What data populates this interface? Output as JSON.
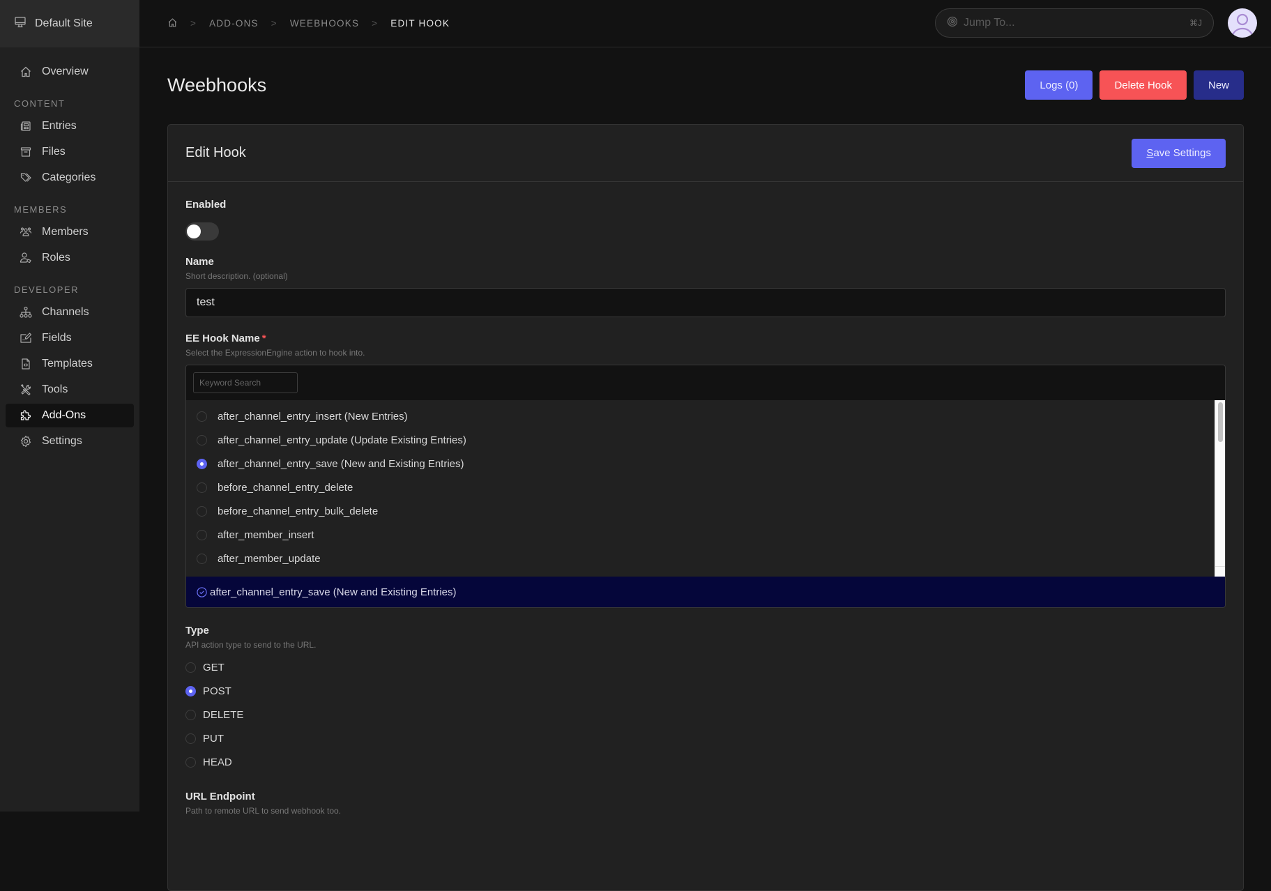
{
  "sidebar": {
    "site_name": "Default Site",
    "overview": "Overview",
    "sections": [
      {
        "title": "CONTENT",
        "items": [
          {
            "label": "Entries",
            "icon": "newspaper-icon"
          },
          {
            "label": "Files",
            "icon": "archive-box-icon"
          },
          {
            "label": "Categories",
            "icon": "tags-icon"
          }
        ]
      },
      {
        "title": "MEMBERS",
        "items": [
          {
            "label": "Members",
            "icon": "users-icon"
          },
          {
            "label": "Roles",
            "icon": "user-tag-icon"
          }
        ]
      },
      {
        "title": "DEVELOPER",
        "items": [
          {
            "label": "Channels",
            "icon": "sitemap-icon"
          },
          {
            "label": "Fields",
            "icon": "pen-field-icon"
          },
          {
            "label": "Templates",
            "icon": "file-code-icon"
          },
          {
            "label": "Tools",
            "icon": "tools-icon"
          },
          {
            "label": "Add-Ons",
            "icon": "puzzle-icon",
            "active": true
          },
          {
            "label": "Settings",
            "icon": "gear-icon"
          }
        ]
      }
    ]
  },
  "topbar": {
    "breadcrumb": [
      "ADD-ONS",
      "WEEBHOOKS",
      "EDIT HOOK"
    ],
    "jump_placeholder": "Jump To...",
    "jump_shortcut": "⌘J"
  },
  "page": {
    "title": "Weebhooks",
    "buttons": {
      "logs": "Logs (0)",
      "delete": "Delete Hook",
      "new": "New"
    }
  },
  "panel": {
    "title": "Edit Hook",
    "save_label": "Save Settings",
    "enabled": {
      "label": "Enabled",
      "value": false
    },
    "name": {
      "label": "Name",
      "desc": "Short description. (optional)",
      "value": "test"
    },
    "hook": {
      "label": "EE Hook Name",
      "required": "*",
      "desc": "Select the ExpressionEngine action to hook into.",
      "search_placeholder": "Keyword Search",
      "options": [
        "after_channel_entry_insert (New Entries)",
        "after_channel_entry_update (Update Existing Entries)",
        "after_channel_entry_save (New and Existing Entries)",
        "before_channel_entry_delete",
        "before_channel_entry_bulk_delete",
        "after_member_insert",
        "after_member_update"
      ],
      "selected_index": 2,
      "selected_label": "after_channel_entry_save (New and Existing Entries)"
    },
    "type": {
      "label": "Type",
      "desc": "API action type to send to the URL.",
      "options": [
        "GET",
        "POST",
        "DELETE",
        "PUT",
        "HEAD"
      ],
      "selected_index": 1
    },
    "url": {
      "label": "URL Endpoint",
      "desc": "Path to remote URL to send webhook too."
    }
  }
}
